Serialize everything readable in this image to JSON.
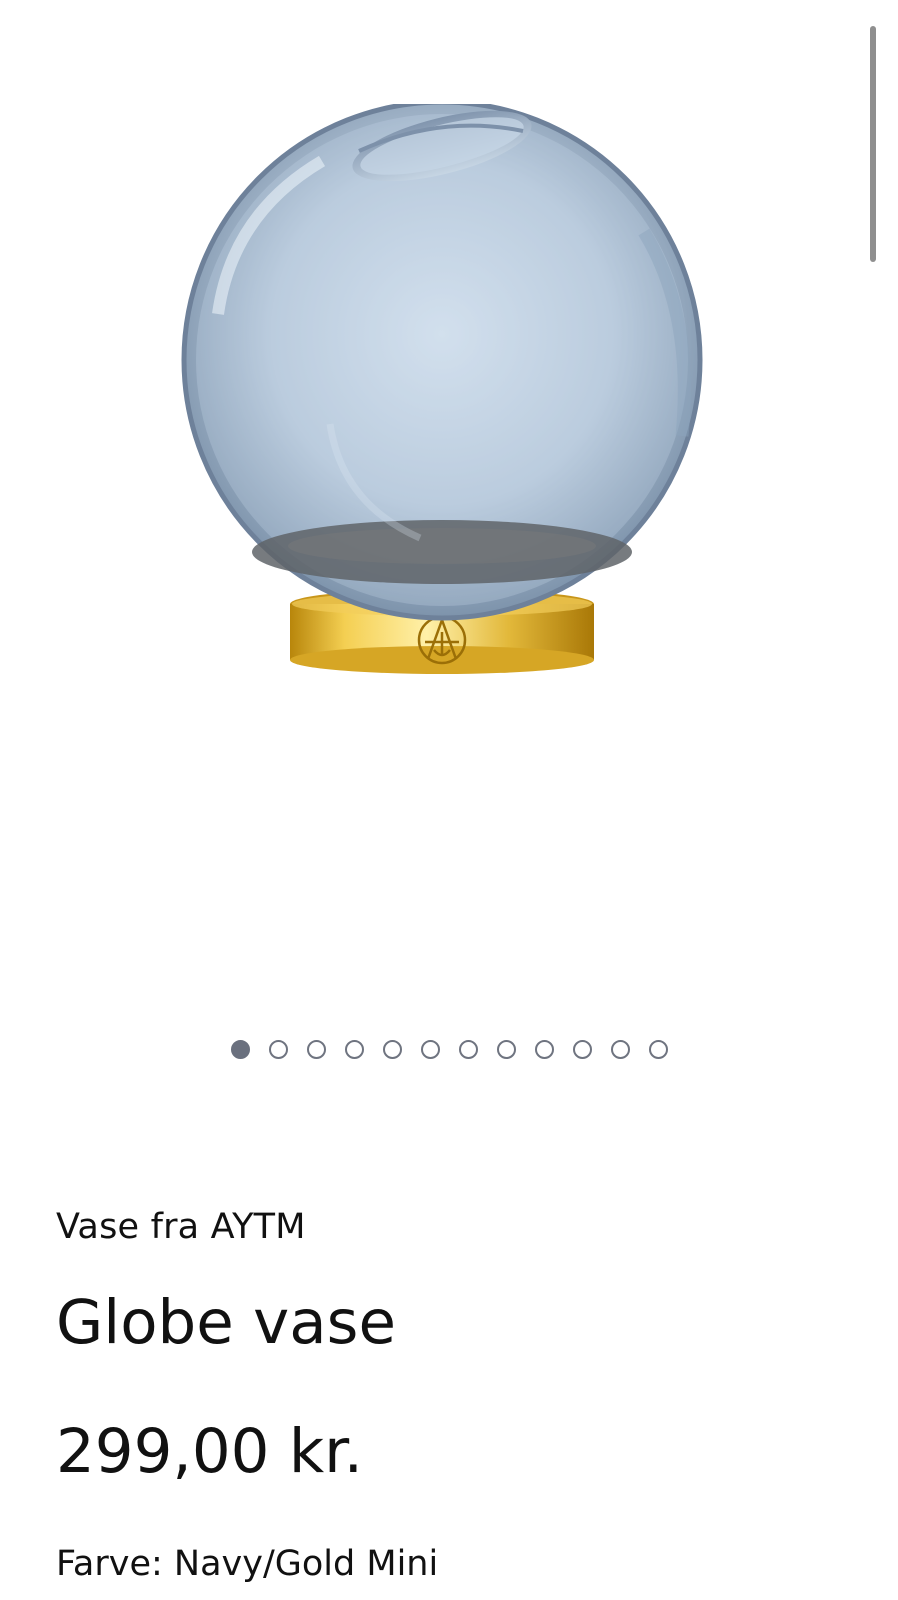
{
  "gallery": {
    "image_alt": "Globe vase Navy/Gold Mini",
    "slide_count": 12,
    "active_slide": 1
  },
  "product": {
    "brand_line": "Vase fra AYTM",
    "title": "Globe vase",
    "price": "299,00 kr.",
    "variant": "Farve: Navy/Gold Mini"
  },
  "colors": {
    "glass": "#9fb2c8",
    "gold": "#d7a72a",
    "dot": "#6a707e"
  }
}
